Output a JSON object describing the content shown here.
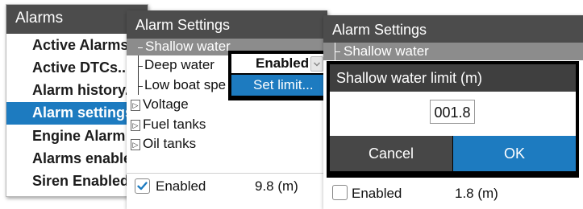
{
  "alarms_panel": {
    "title": "Alarms",
    "items": [
      {
        "label": "Active Alarms..."
      },
      {
        "label": "Active DTCs..."
      },
      {
        "label": "Alarm history..."
      },
      {
        "label": "Alarm settings..."
      },
      {
        "label": "Engine Alarm S"
      },
      {
        "label": "Alarms enabled"
      },
      {
        "label": "Siren Enabled"
      }
    ],
    "selected_index": 3
  },
  "settings_panel": {
    "title": "Alarm Settings",
    "selected_item": "Shallow water",
    "items": [
      {
        "label": "Deep water"
      },
      {
        "label": "Low boat spe"
      }
    ],
    "groups": [
      {
        "label": "Voltage"
      },
      {
        "label": "Fuel tanks"
      },
      {
        "label": "Oil tanks"
      }
    ],
    "expander_icon": "▷",
    "footer": {
      "checkbox_label": "Enabled",
      "checked": true,
      "value": "9.8 (m)"
    },
    "popup": {
      "enabled_label": "Enabled",
      "set_limit_label": "Set limit..."
    }
  },
  "limit_panel": {
    "title": "Alarm Settings",
    "selected_item": "Shallow water",
    "dialog": {
      "title": "Shallow water limit (m)",
      "value": "001.8",
      "cancel_label": "Cancel",
      "ok_label": "OK"
    },
    "footer": {
      "checkbox_label": "Enabled",
      "checked": false,
      "value": "1.8 (m)"
    }
  },
  "colors": {
    "header": "#4c4c4c",
    "selection_blue": "#1d7bc0",
    "selection_gray": "#8c8c8c"
  }
}
